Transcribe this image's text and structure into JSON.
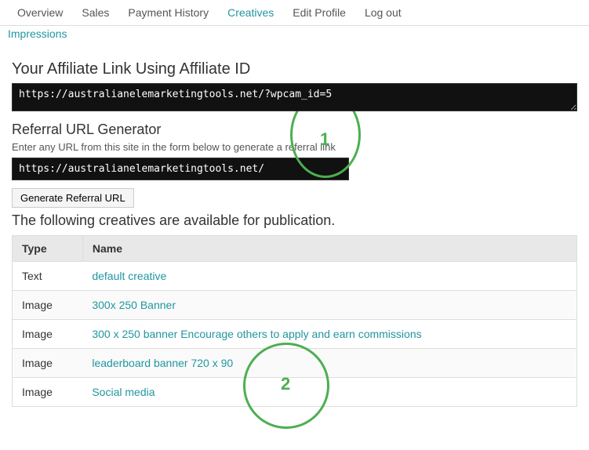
{
  "nav": {
    "items": [
      {
        "label": "Overview",
        "active": false
      },
      {
        "label": "Sales",
        "active": false
      },
      {
        "label": "Payment History",
        "active": false
      },
      {
        "label": "Creatives",
        "active": true
      },
      {
        "label": "Edit Profile",
        "active": false
      },
      {
        "label": "Log out",
        "active": false
      }
    ],
    "sub_items": [
      {
        "label": "Impressions"
      }
    ]
  },
  "affiliate_section": {
    "title": "Your Affiliate Link Using Affiliate ID",
    "link_value": "https://australianelemarketingtools.net/?wpcam_id=5",
    "circle1_label": "1"
  },
  "referral_section": {
    "title": "Referral URL Generator",
    "description": "Enter any URL from this site in the form below to generate a referral link",
    "url_value": "https://australianelemarketingtools.net/",
    "button_label": "Generate Referral URL"
  },
  "creatives_section": {
    "title": "The following creatives are available for publication.",
    "circle2_label": "2",
    "table": {
      "headers": [
        "Type",
        "Name"
      ],
      "rows": [
        {
          "type": "Text",
          "name": "default creative"
        },
        {
          "type": "Image",
          "name": "300x 250 Banner"
        },
        {
          "type": "Image",
          "name": "300 x 250 banner Encourage others to apply and earn commissions"
        },
        {
          "type": "Image",
          "name": "leaderboard banner 720 x 90"
        },
        {
          "type": "Image",
          "name": "Social media"
        }
      ]
    }
  }
}
